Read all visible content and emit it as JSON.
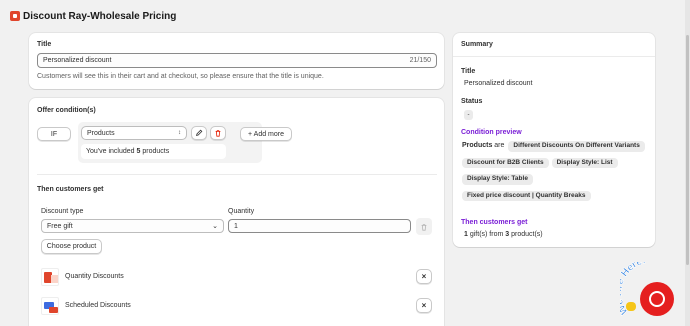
{
  "header": {
    "title": "Discount Ray-Wholesale Pricing",
    "logo_icon": "app-logo-icon"
  },
  "title_card": {
    "heading": "Title",
    "value": "Personalized discount",
    "counter": "21/150",
    "help": "Customers will see this in their cart and at checkout, so please ensure that the title is unique."
  },
  "offer": {
    "heading": "Offer condition(s)",
    "if_label": "IF",
    "select_value": "Products",
    "add_more": "+ Add more",
    "included_prefix": "You've included ",
    "included_count": "5",
    "included_suffix": " products"
  },
  "then": {
    "heading": "Then customers get",
    "discount_type_label": "Discount type",
    "discount_type_value": "Free gift",
    "quantity_label": "Quantity",
    "quantity_value": "1",
    "choose_product": "Choose product",
    "products": [
      {
        "name": "Quantity Discounts"
      },
      {
        "name": "Scheduled Discounts"
      }
    ]
  },
  "summary": {
    "heading": "Summary",
    "title_label": "Title",
    "title_value": "Personalized discount",
    "status_label": "Status",
    "status_value": "-",
    "preview_label": "Condition preview",
    "products_word": "Products",
    "are_word": " are",
    "chips": [
      "Different Discounts On Different Variants",
      "Discount for B2B Clients",
      "Display Style: List",
      "Display Style: Table",
      "Fixed price discount | Quantity Breaks"
    ],
    "then_label": "Then customers get",
    "then_count": "1",
    "then_text1": " gift(s) from ",
    "then_count2": "3",
    "then_text2": " product(s)"
  },
  "chat": {
    "badge": "We Are Here!",
    "icon": "chat-bubble-icon"
  },
  "colors": {
    "accent_purple": "#7a1fd6",
    "danger": "#e51c00",
    "chat_red": "#e51f1f"
  }
}
